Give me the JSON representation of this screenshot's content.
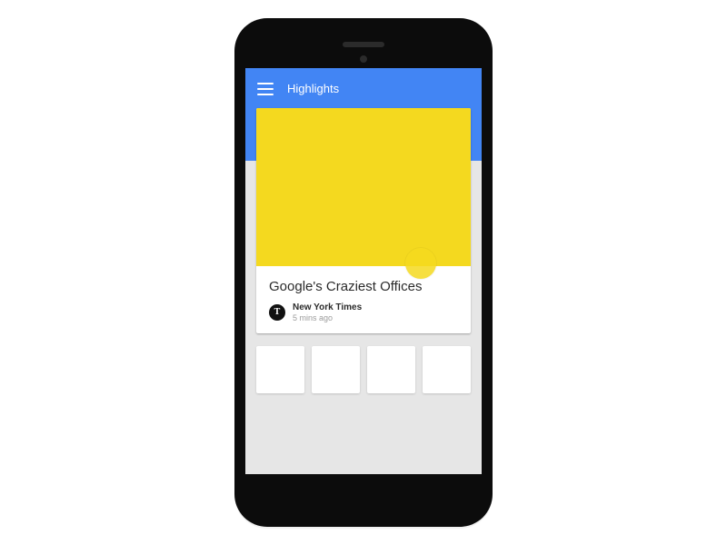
{
  "colors": {
    "accent": "#4285f4",
    "hero": "#f4d91f"
  },
  "appbar": {
    "menu_icon": "menu-icon",
    "title": "Highlights"
  },
  "feed": {
    "main_card": {
      "title": "Google's Craziest Offices",
      "source_name": "New York Times",
      "source_glyph": "T",
      "time": "5 mins ago"
    },
    "thumbnails": [
      {},
      {},
      {},
      {}
    ]
  }
}
